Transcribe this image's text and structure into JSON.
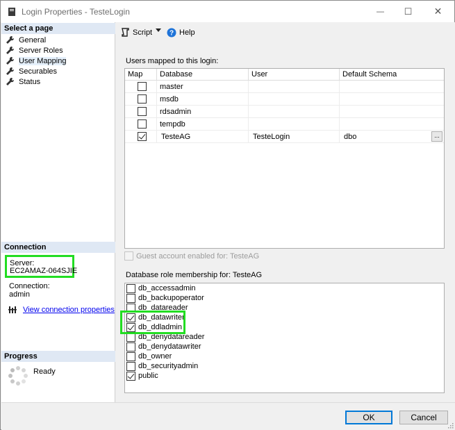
{
  "window": {
    "title": "Login Properties - TesteLogin",
    "minimize": "—",
    "maximize": "☐",
    "close": "✕"
  },
  "left": {
    "select_page_header": "Select a page",
    "pages": [
      {
        "label": "General"
      },
      {
        "label": "Server Roles"
      },
      {
        "label": "User Mapping"
      },
      {
        "label": "Securables"
      },
      {
        "label": "Status"
      }
    ],
    "connection_header": "Connection",
    "server_label": "Server:",
    "server_value": "EC2AMAZ-064SJIE",
    "connection_label": "Connection:",
    "connection_value": "admin",
    "view_connection_link": "View connection properties",
    "progress_header": "Progress",
    "progress_status": "Ready"
  },
  "toolbar": {
    "script_label": "Script",
    "help_label": "Help"
  },
  "users_mapped": {
    "label": "Users mapped to this login:",
    "columns": [
      "Map",
      "Database",
      "User",
      "Default Schema"
    ],
    "rows": [
      {
        "map": false,
        "database": "master",
        "user": "",
        "schema": ""
      },
      {
        "map": false,
        "database": "msdb",
        "user": "",
        "schema": ""
      },
      {
        "map": false,
        "database": "rdsadmin",
        "user": "",
        "schema": ""
      },
      {
        "map": false,
        "database": "tempdb",
        "user": "",
        "schema": ""
      },
      {
        "map": true,
        "database": "TesteAG",
        "user": "TesteLogin",
        "schema": "dbo",
        "ellipsis": "..."
      }
    ]
  },
  "guest": {
    "label": "Guest account enabled for: TesteAG",
    "checked": false
  },
  "roles": {
    "label": "Database role membership for: TesteAG",
    "items": [
      {
        "name": "db_accessadmin",
        "checked": false
      },
      {
        "name": "db_backupoperator",
        "checked": false
      },
      {
        "name": "db_datareader",
        "checked": false
      },
      {
        "name": "db_datawriter",
        "checked": true
      },
      {
        "name": "db_ddladmin",
        "checked": true
      },
      {
        "name": "db_denydatareader",
        "checked": false
      },
      {
        "name": "db_denydatawriter",
        "checked": false
      },
      {
        "name": "db_owner",
        "checked": false
      },
      {
        "name": "db_securityadmin",
        "checked": false
      },
      {
        "name": "public",
        "checked": true
      }
    ]
  },
  "buttons": {
    "ok": "OK",
    "cancel": "Cancel"
  },
  "colors": {
    "highlight": "#22dd22",
    "accent": "#0078d7",
    "section_bg": "#dfe8f4"
  }
}
